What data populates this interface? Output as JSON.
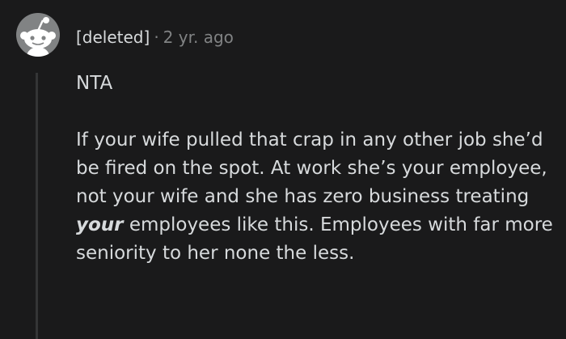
{
  "comment": {
    "author": "[deleted]",
    "separator": "·",
    "age": "2 yr. ago",
    "avatar_icon": "snoo-avatar-icon",
    "paragraphs": {
      "p1": "NTA",
      "p2_part1": "If your wife pulled that crap in any other job she’d be fired on the spot. At work she’s your employee, not your wife and she has zero business treating ",
      "p2_emphasis": "your",
      "p2_part2": " employees like this. Employees with far more seniority to her none the less."
    }
  },
  "colors": {
    "background": "#1a1a1b",
    "text": "#d7dadc",
    "muted": "#818384",
    "thread_line": "#343536",
    "avatar_bg": "#818384"
  }
}
